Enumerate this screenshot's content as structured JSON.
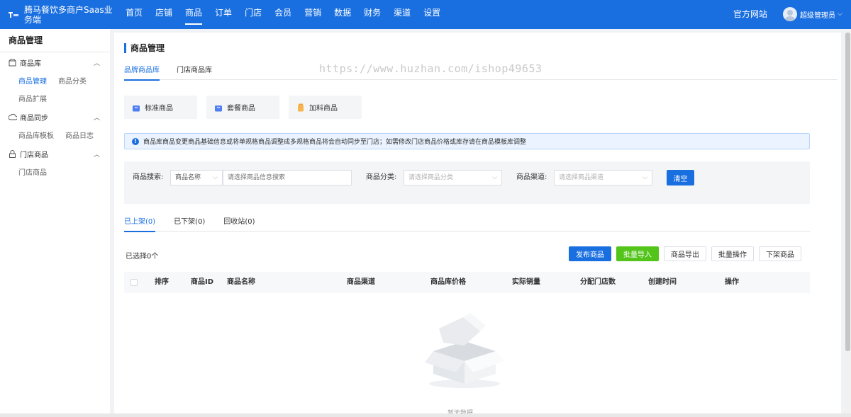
{
  "header": {
    "brand": "腾马餐饮多商户Saas业务端",
    "nav": [
      "首页",
      "店铺",
      "商品",
      "订单",
      "门店",
      "会员",
      "营销",
      "数据",
      "财务",
      "渠道",
      "设置"
    ],
    "active_nav": 2,
    "official_site": "官方网站",
    "user_name": "超级管理员",
    "brand_color": "#1a6fe0"
  },
  "sidebar": {
    "title": "商品管理",
    "groups": [
      {
        "label": "商品库",
        "icon": "box-icon",
        "items": [
          [
            "商品管理",
            "商品分类"
          ],
          [
            "商品扩展"
          ]
        ]
      },
      {
        "label": "商品同步",
        "icon": "cloud-sync-icon",
        "items": [
          [
            "商品库模板",
            "商品日志"
          ]
        ]
      },
      {
        "label": "门店商品",
        "icon": "lock-icon",
        "items": [
          [
            "门店商品"
          ]
        ]
      }
    ],
    "active_item": "商品管理"
  },
  "main": {
    "title": "商品管理",
    "lib_tabs": [
      "品牌商品库",
      "门店商品库"
    ],
    "watermark": "https://www.huzhan.com/ishop49653",
    "types": [
      "标准商品",
      "套餐商品",
      "加料商品"
    ],
    "notice": "商品库商品变更商品基础信息或将单规格商品调整成多规格商品将会自动同步至门店；如需修改门店商品价格或库存请在商品模板库调整",
    "filters": {
      "search_label": "商品搜索:",
      "search_type": "商品名称",
      "search_placeholder": "请选择商品信息搜索",
      "category_label": "商品分类:",
      "category_placeholder": "请选择商品分类",
      "channel_label": "商品渠道:",
      "channel_placeholder": "请选择商品渠道",
      "clear": "清空"
    },
    "status_tabs": [
      "已上架(0)",
      "已下架(0)",
      "回收站(0)"
    ],
    "selected": "已选择0个",
    "actions": {
      "publish": "发布商品",
      "import": "批量导入",
      "export": "商品导出",
      "batch": "批量操作",
      "offshelf": "下架商品"
    },
    "columns": [
      "排序",
      "商品ID",
      "商品名称",
      "商品渠道",
      "商品库价格",
      "实际销量",
      "分配门店数",
      "创建时间",
      "操作"
    ],
    "empty_text": "暂无数据"
  }
}
